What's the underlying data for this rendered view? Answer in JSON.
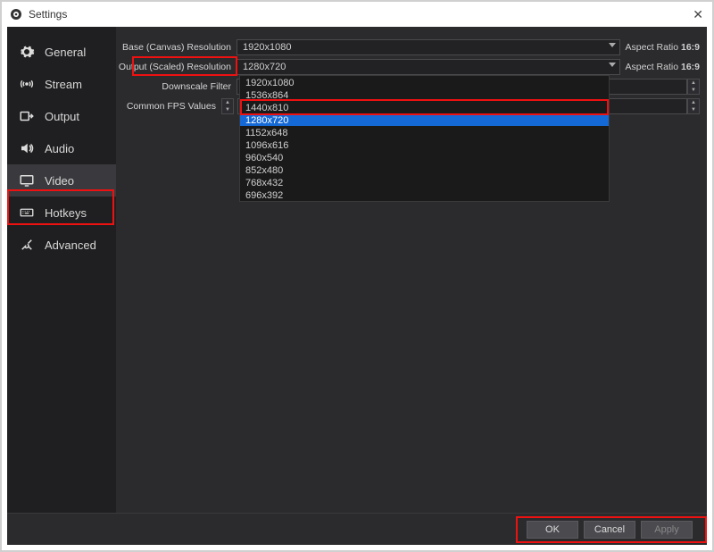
{
  "window": {
    "title": "Settings"
  },
  "sidebar": {
    "items": [
      {
        "label": "General"
      },
      {
        "label": "Stream"
      },
      {
        "label": "Output"
      },
      {
        "label": "Audio"
      },
      {
        "label": "Video"
      },
      {
        "label": "Hotkeys"
      },
      {
        "label": "Advanced"
      }
    ]
  },
  "labels": {
    "base": "Base (Canvas) Resolution",
    "output": "Output (Scaled) Resolution",
    "downscale": "Downscale Filter",
    "fps": "Common FPS Values",
    "aspect_prefix": "Aspect Ratio",
    "aspect_value": "16:9"
  },
  "fields": {
    "base_value": "1920x1080",
    "output_value": "1280x720"
  },
  "dropdown_options": [
    "1920x1080",
    "1536x864",
    "1440x810",
    "1280x720",
    "1152x648",
    "1096x616",
    "960x540",
    "852x480",
    "768x432",
    "696x392"
  ],
  "dropdown_selected_index": 3,
  "footer": {
    "ok": "OK",
    "cancel": "Cancel",
    "apply": "Apply"
  }
}
